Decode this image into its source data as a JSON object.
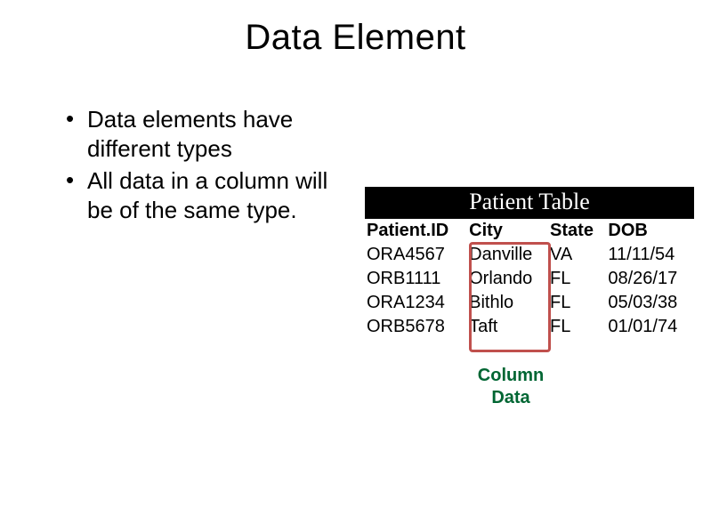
{
  "title": "Data Element",
  "bullets": [
    "Data elements have different types",
    "All data in a column will be of the same type."
  ],
  "table": {
    "caption": "Patient Table",
    "headers": [
      "Patient.ID",
      "City",
      "State",
      "DOB"
    ],
    "rows": [
      [
        "ORA4567",
        "Danville",
        "VA",
        "11/11/54"
      ],
      [
        "ORB1111",
        "Orlando",
        "FL",
        "08/26/17"
      ],
      [
        "ORA1234",
        "Bithlo",
        "FL",
        "05/03/38"
      ],
      [
        "ORB5678",
        "Taft",
        "FL",
        "01/01/74"
      ]
    ]
  },
  "highlight": {
    "label_line1": "Column",
    "label_line2": "Data"
  }
}
